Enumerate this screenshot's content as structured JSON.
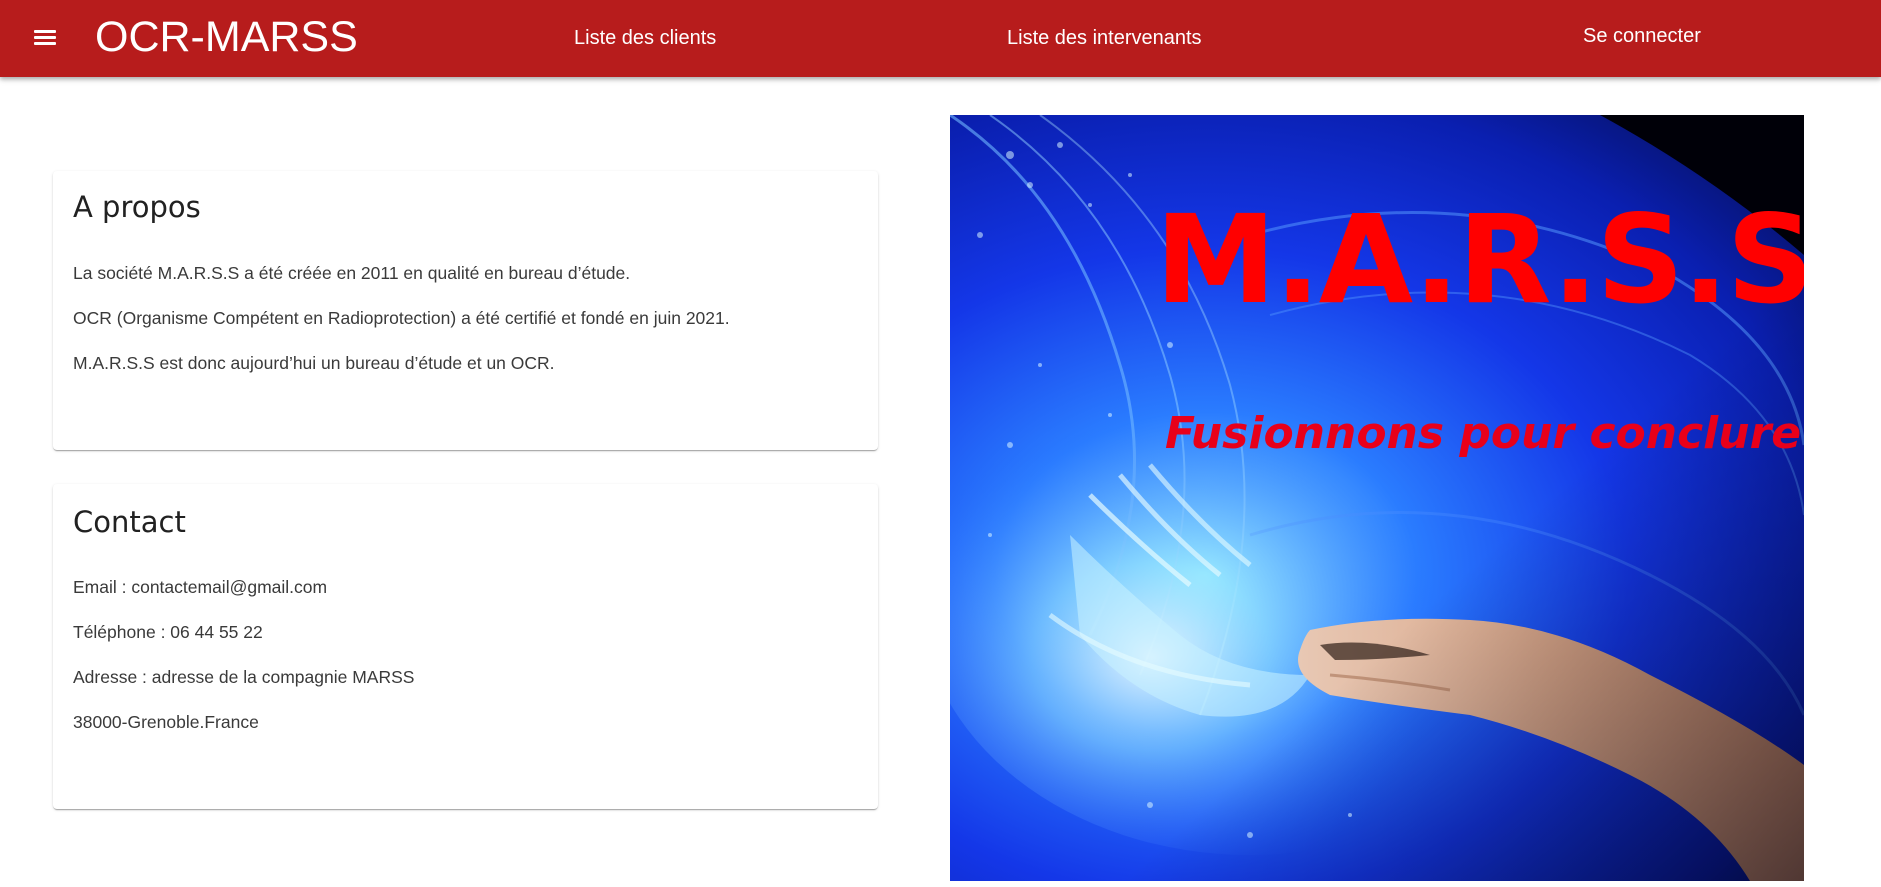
{
  "header": {
    "brand": "OCR-MARSS",
    "menu_icon": "menu-icon",
    "nav": {
      "clients": "Liste des clients",
      "intervenants": "Liste des intervenants",
      "login": "Se connecter"
    },
    "color": "#b71c1c"
  },
  "about": {
    "title": "A propos",
    "lines": [
      "La société M.A.R.S.S a été créée en 2011 en qualité en bureau d’étude.",
      "OCR (Organisme Compétent en Radioprotection) a été certifié et fondé en juin 2021.",
      "M.A.R.S.S est donc aujourd’hui un bureau d’étude et un OCR."
    ]
  },
  "contact": {
    "title": "Contact",
    "lines": [
      "Email : contactemail@gmail.com",
      "Téléphone : 06 44 55 22",
      "Adresse : adresse de la compagnie MARSS",
      "38000-Grenoble.France"
    ]
  },
  "hero": {
    "title": "M.A.R.S.S",
    "tagline": "Fusionnons pour conclure"
  }
}
